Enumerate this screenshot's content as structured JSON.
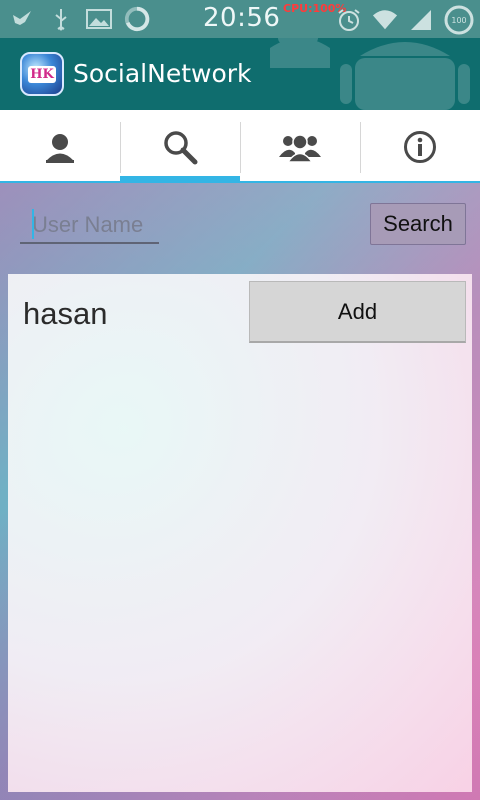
{
  "status_bar": {
    "time": "20:56",
    "cpu": "CPU:100%",
    "battery": "100"
  },
  "action_bar": {
    "logo_text": "HK",
    "title": "SocialNetwork"
  },
  "tabs": [
    {
      "icon": "person-icon",
      "active": false
    },
    {
      "icon": "search-icon",
      "active": true
    },
    {
      "icon": "group-icon",
      "active": false
    },
    {
      "icon": "info-icon",
      "active": false
    }
  ],
  "search": {
    "placeholder": "User Name",
    "value": "",
    "button_label": "Search"
  },
  "results": [
    {
      "name": "hasan",
      "action_label": "Add"
    }
  ],
  "colors": {
    "status_bar": "#4a8f8d",
    "action_bar": "#0f6d6e",
    "tab_indicator": "#33b5e5",
    "cpu_text": "#ff3b3b"
  }
}
